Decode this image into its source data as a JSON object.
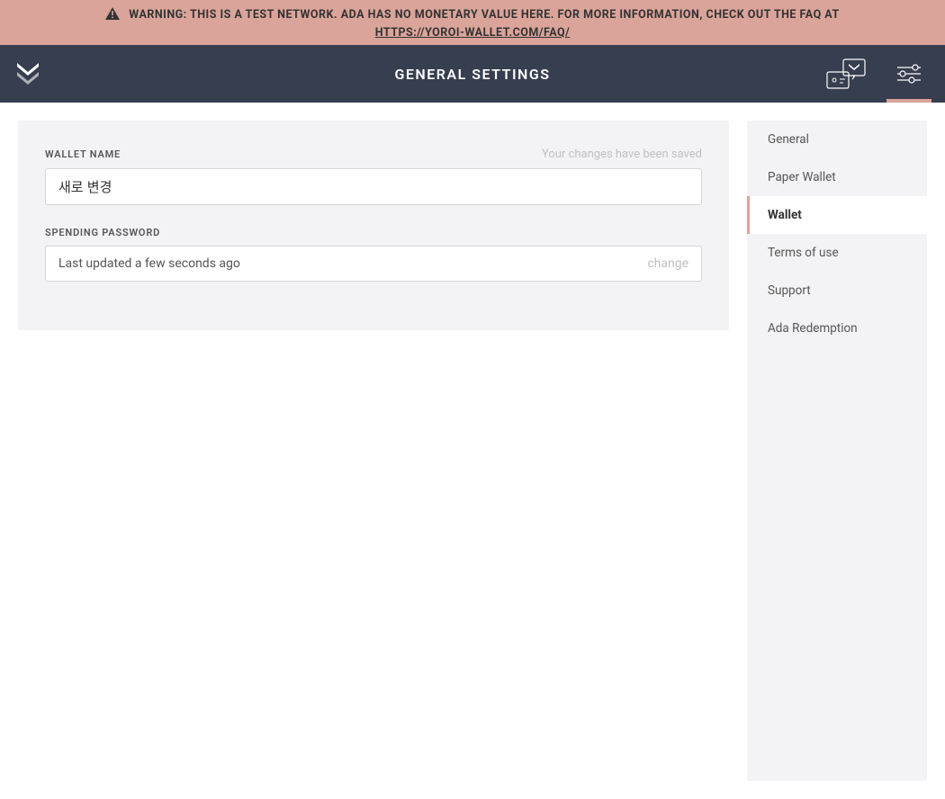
{
  "warning": {
    "text": "WARNING: THIS IS A TEST NETWORK. ADA HAS NO MONETARY VALUE HERE. FOR MORE INFORMATION, CHECK OUT THE FAQ AT",
    "link_text": "HTTPS://YOROI-WALLET.COM/FAQ/"
  },
  "header": {
    "title": "GENERAL SETTINGS"
  },
  "main": {
    "wallet_name_label": "WALLET NAME",
    "wallet_name_status": "Your changes have been saved",
    "wallet_name_value": "새로 변경",
    "spending_password_label": "SPENDING PASSWORD",
    "spending_password_status": "Last updated a few seconds ago",
    "change_label": "change"
  },
  "sidebar": {
    "items": [
      {
        "label": "General",
        "active": false
      },
      {
        "label": "Paper Wallet",
        "active": false
      },
      {
        "label": "Wallet",
        "active": true
      },
      {
        "label": "Terms of use",
        "active": false
      },
      {
        "label": "Support",
        "active": false
      },
      {
        "label": "Ada Redemption",
        "active": false
      }
    ]
  }
}
